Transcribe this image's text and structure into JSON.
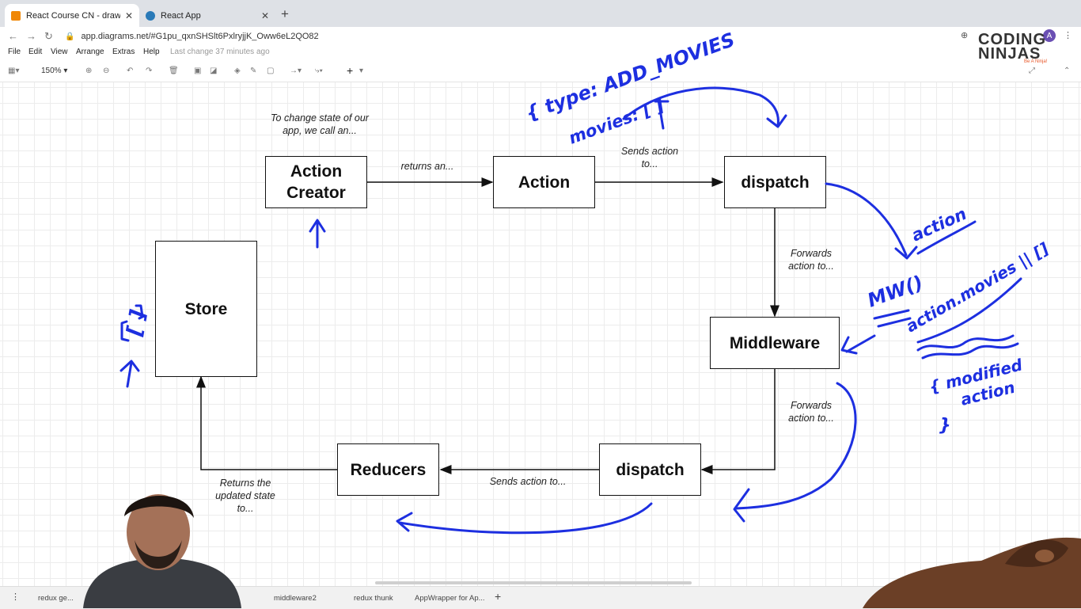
{
  "browser": {
    "tabs": [
      {
        "title": "React Course CN - draw.io",
        "favicon_color": "#f08705",
        "active": true
      },
      {
        "title": "React App",
        "favicon_color": "#2a7ab8",
        "active": false
      }
    ],
    "url": "app.diagrams.net/#G1pu_qxnSHSlt6PxlryjjK_Oww6eL2QO82",
    "profile_initial": "A"
  },
  "menu": {
    "items": [
      "File",
      "Edit",
      "View",
      "Arrange",
      "Extras",
      "Help"
    ],
    "status": "Last change 37 minutes ago"
  },
  "toolbar": {
    "zoom": "150%"
  },
  "logo": {
    "line1": "CODING",
    "line2": "NINJAS",
    "tagline": "Be A Ninja!"
  },
  "diagram": {
    "boxes": {
      "action_creator": "Action Creator",
      "action": "Action",
      "dispatch_top": "dispatch",
      "store": "Store",
      "middleware": "Middleware",
      "reducers": "Reducers",
      "dispatch_bottom": "dispatch"
    },
    "labels": {
      "intro": "To change state of our app, we call an...",
      "returns": "returns an...",
      "sends_action": "Sends action to...",
      "forwards_1": "Forwards action to...",
      "forwards_2": "Forwards action to...",
      "sends_action_2": "Sends action to...",
      "returns_updated": "Returns the updated state to..."
    },
    "annotations": {
      "type_add_movies": "{ type: ADD_MOVIES",
      "movies_empty": "movies: [ ]",
      "action": "action",
      "mw": "MW()",
      "action_movies": "action.movies || []",
      "modified": "{ modified",
      "action_word": "action",
      "close_brace": "}",
      "store_empty": "[ ]"
    },
    "annotation_color": "#1d2fe0"
  },
  "pages": [
    "redux ge...",
    "middleware2",
    "redux thunk",
    "AppWrapper for Ap..."
  ]
}
